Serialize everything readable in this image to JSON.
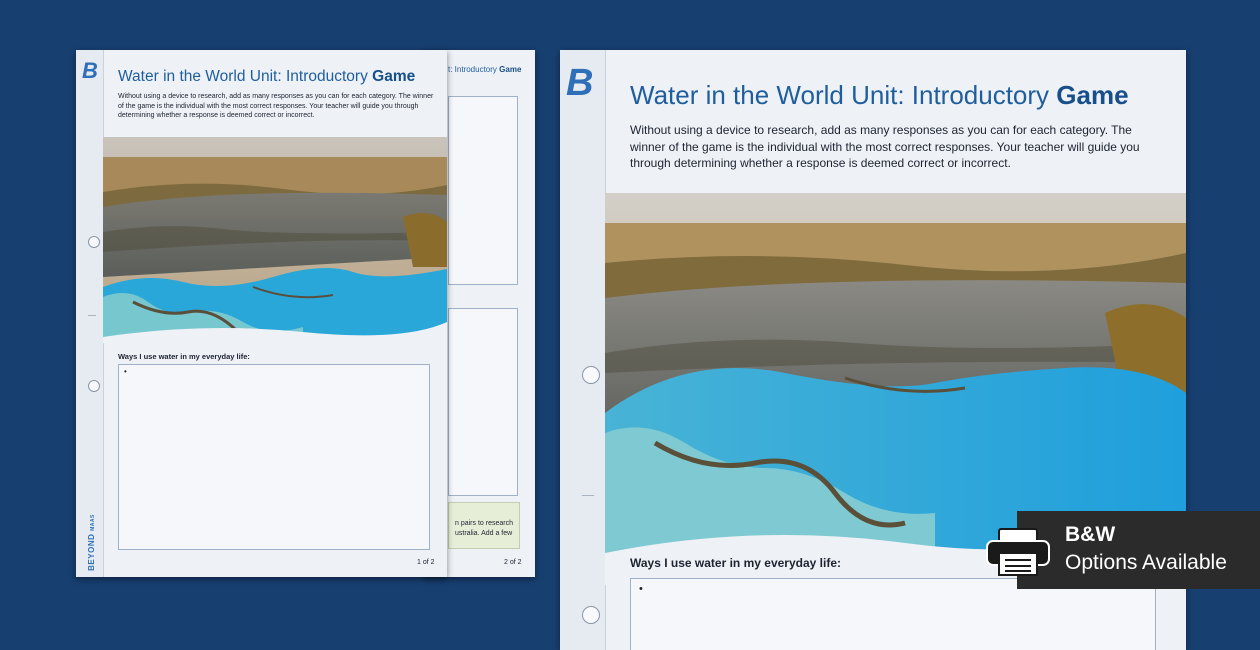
{
  "worksheet": {
    "title_main": "Water in the World Unit: Introductory",
    "title_bold": "Game",
    "intro": "Without using a device to research, add as many responses as you can for each category. The winner of the game is the individual with the most correct responses. Your teacher will guide you through determining whether a response is deemed correct or incorrect.",
    "prompt": "Ways I use water in my everyday life:",
    "bullet": "•",
    "page1_label": "1 of 2",
    "page2_label": "2 of 2",
    "back_title_fragment": "t: Introductory",
    "back_title_fragment_bold": "Game",
    "back_note_line1": "n pairs to research",
    "back_note_line2": "ustralia. Add a few",
    "brand_logo": "B",
    "brand_name": "BEYOND",
    "brand_name_small": "MAAS"
  },
  "badge": {
    "line1": "B&W",
    "line2": "Options Available",
    "icon": "printer-icon"
  },
  "colors": {
    "background": "#173f70",
    "title": "#1f5e9e",
    "water": "#2aa7d9"
  }
}
